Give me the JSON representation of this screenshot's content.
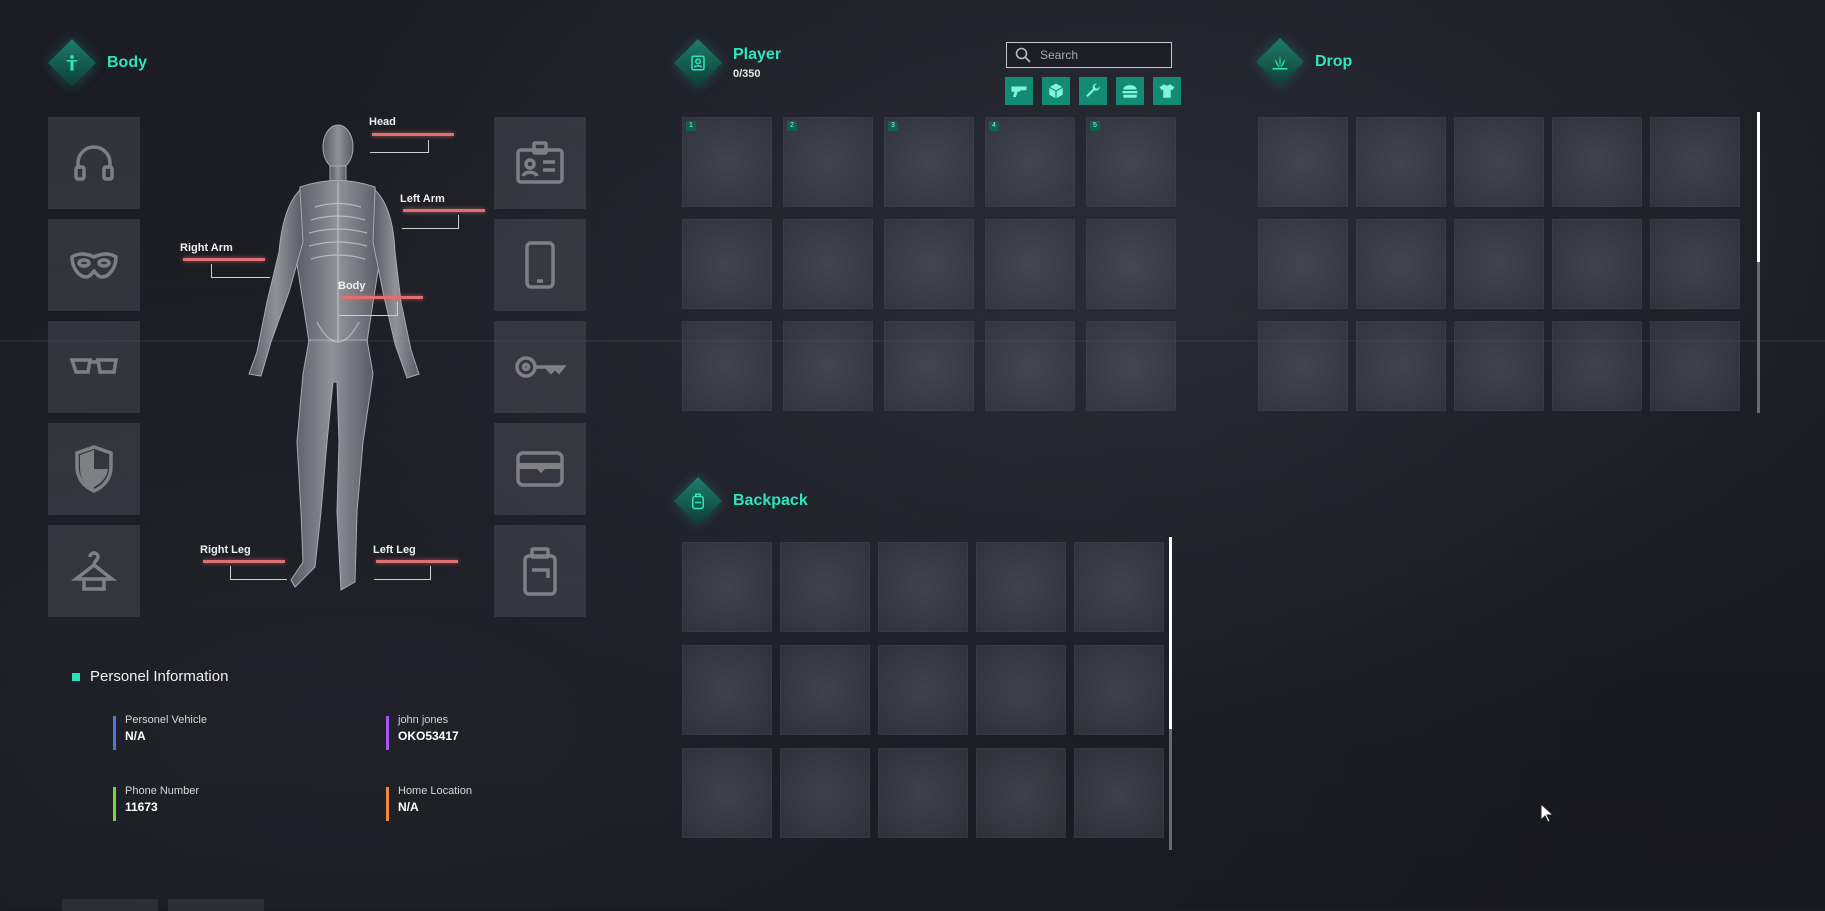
{
  "body_section": {
    "title": "Body",
    "icon": "person-icon"
  },
  "player_section": {
    "title": "Player",
    "weight": "0/350",
    "icon": "player-card-icon"
  },
  "drop_section": {
    "title": "Drop",
    "icon": "grass-icon"
  },
  "backpack_section": {
    "title": "Backpack",
    "icon": "backpack-icon"
  },
  "search": {
    "placeholder": "Search",
    "value": ""
  },
  "filters": [
    "gun-icon",
    "box-icon",
    "wrench-icon",
    "burger-icon",
    "shirt-icon"
  ],
  "body_parts": {
    "head": "Head",
    "left_arm": "Left Arm",
    "right_arm": "Right Arm",
    "body": "Body",
    "right_leg": "Right Leg",
    "left_leg": "Left Leg"
  },
  "equipment_left": [
    "headphones-icon",
    "mask-icon",
    "glasses-icon",
    "armor-icon",
    "hanger-icon"
  ],
  "equipment_right": [
    "id-card-icon",
    "phone-icon",
    "key-icon",
    "wallet-icon",
    "bag-icon"
  ],
  "player_slot_numbers": [
    "1",
    "2",
    "3",
    "4",
    "5"
  ],
  "info": {
    "title": "Personel Information",
    "vehicle": {
      "label": "Personel Vehicle",
      "value": "N/A",
      "color": "#4a78e0"
    },
    "name": {
      "label": "john jones",
      "value": "OKO53417",
      "color": "#a855f7"
    },
    "phone": {
      "label": "Phone Number",
      "value": "11673",
      "color": "#6fdc3a"
    },
    "home": {
      "label": "Home Location",
      "value": "N/A",
      "color": "#f0893a"
    }
  },
  "colors": {
    "accent": "#2ee6bd",
    "health": "#e07070"
  }
}
